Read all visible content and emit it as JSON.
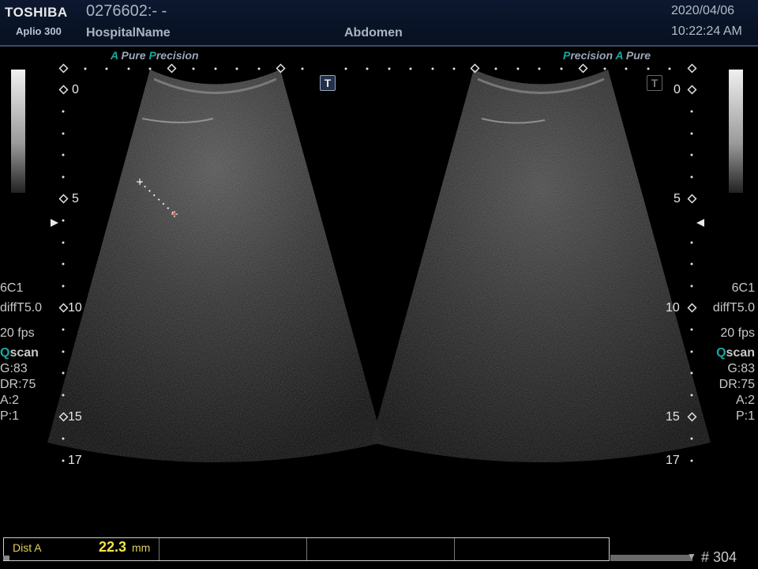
{
  "header": {
    "brand": "TOSHIBA",
    "model": "Aplio 300",
    "patient_id": "0276602:- -",
    "hospital": "HospitalName",
    "preset": "Abdomen",
    "date": "2020/04/06",
    "time": "10:22:24 AM"
  },
  "left_pane": {
    "brand_a": "A",
    "brand_pure": "Pure",
    "brand_p": "P",
    "brand_precision": "recision",
    "depth_labels": [
      "0",
      "5",
      "10",
      "15",
      "17"
    ],
    "params": {
      "probe": "6C1",
      "mode": "diffT5.0",
      "fps": "20 fps",
      "qscan_q": "Q",
      "qscan_rest": "scan",
      "gain": "G:83",
      "dynamic_range": "DR:75",
      "a": "A:2",
      "p": "P:1"
    }
  },
  "right_pane": {
    "brand_p": "P",
    "brand_precision": "recision",
    "brand_a": "A",
    "brand_pure": "Pure",
    "depth_labels": [
      "0",
      "5",
      "10",
      "15",
      "17"
    ],
    "params": {
      "probe": "6C1",
      "mode": "diffT5.0",
      "fps": "20 fps",
      "qscan_q": "Q",
      "qscan_rest": "scan",
      "gain": "G:83",
      "dynamic_range": "DR:75",
      "a": "A:2",
      "p": "P:1"
    }
  },
  "t_icon_label": "T",
  "measurement": {
    "label": "Dist A",
    "value": "22.3",
    "unit": "mm"
  },
  "frame_count": "# 304",
  "colors": {
    "header_bg": "#0d1830",
    "accent_teal": "#1aa7a0",
    "measurement_yellow": "#f2e44a"
  }
}
